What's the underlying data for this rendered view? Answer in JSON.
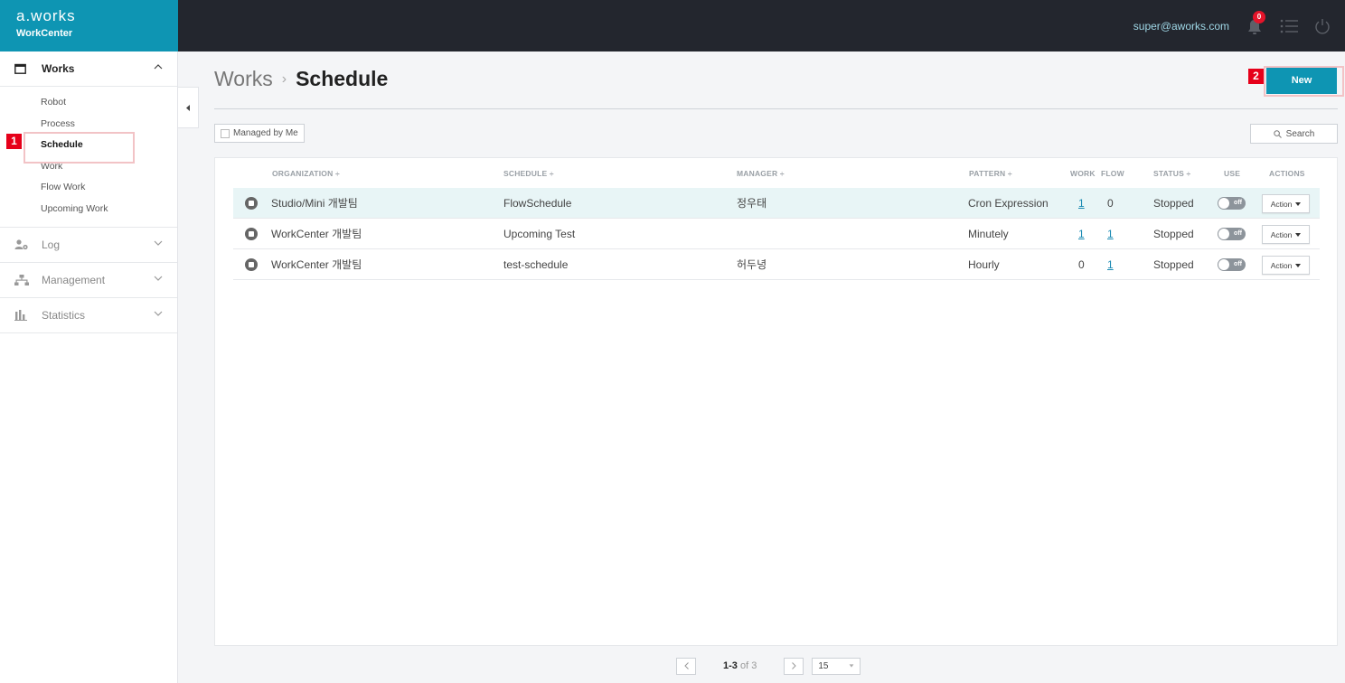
{
  "brand": {
    "logo": "a.works",
    "product": "WorkCenter"
  },
  "header": {
    "user_email": "super@aworks.com",
    "notification_count": "0"
  },
  "sidebar": {
    "sections": [
      {
        "label": "Works",
        "icon": "calendar-icon",
        "expanded": true
      },
      {
        "label": "Log",
        "icon": "user-settings-icon",
        "expanded": false
      },
      {
        "label": "Management",
        "icon": "org-chart-icon",
        "expanded": false
      },
      {
        "label": "Statistics",
        "icon": "bar-chart-icon",
        "expanded": false
      }
    ],
    "works_items": [
      "Robot",
      "Process",
      "Schedule",
      "Work",
      "Flow Work",
      "Upcoming Work"
    ],
    "active_item": "Schedule"
  },
  "page": {
    "breadcrumb_parent": "Works",
    "title": "Schedule",
    "new_label": "New"
  },
  "annotations": {
    "label_1": "1",
    "label_2": "2"
  },
  "filters": {
    "managed_by_me": "Managed by Me",
    "search": "Search"
  },
  "table": {
    "headers": {
      "organization": "ORGANIZATION ÷",
      "schedule": "SCHEDULE ÷",
      "manager": "MANAGER ÷",
      "pattern": "PATTERN ÷",
      "work": "WORK",
      "flow": "FLOW",
      "status": "STATUS ÷",
      "use": "USE",
      "actions": "ACTIONS"
    },
    "rows": [
      {
        "organization": "Studio/Mini 개발팀",
        "schedule": "FlowSchedule",
        "manager": "정우태",
        "pattern": "Cron Expression",
        "work": "1",
        "flow": "0",
        "status": "Stopped",
        "use": "off",
        "action": "Action"
      },
      {
        "organization": "WorkCenter 개발팀",
        "schedule": "Upcoming Test",
        "manager": "",
        "pattern": "Minutely",
        "work": "1",
        "flow": "1",
        "status": "Stopped",
        "use": "off",
        "action": "Action"
      },
      {
        "organization": "WorkCenter 개발팀",
        "schedule": "test-schedule",
        "manager": "허두녕",
        "pattern": "Hourly",
        "work": "0",
        "flow": "1",
        "status": "Stopped",
        "use": "off",
        "action": "Action"
      }
    ]
  },
  "pagination": {
    "range": "1-3",
    "of_total": "of 3",
    "page_size": "15"
  }
}
